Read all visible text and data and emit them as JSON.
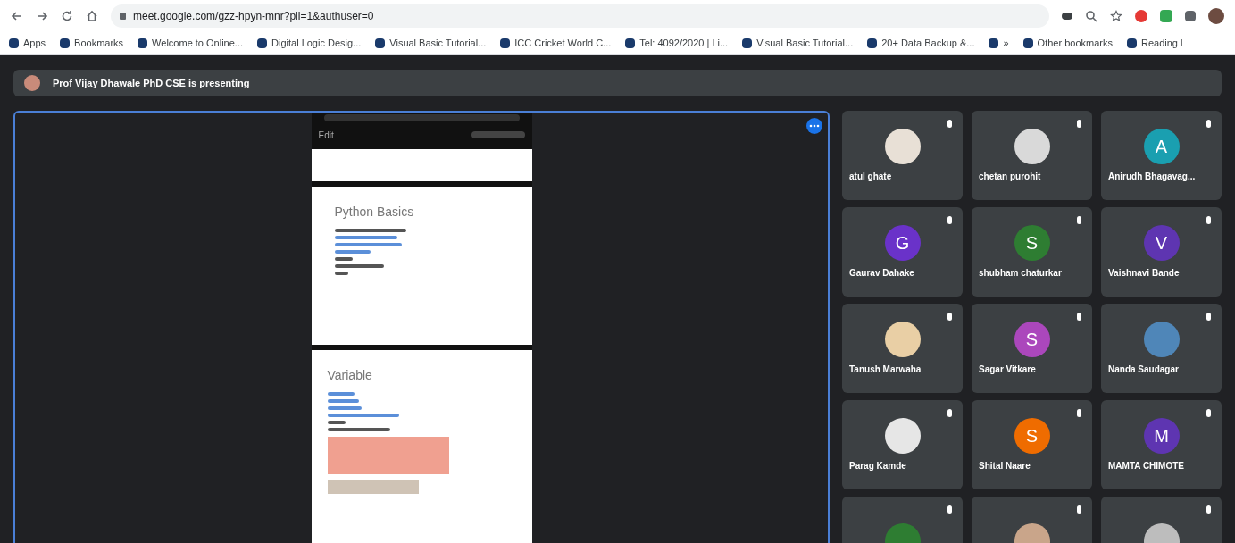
{
  "browser": {
    "url": "meet.google.com/gzz-hpyn-mnr?pli=1&authuser=0",
    "bookmarks": [
      "Apps",
      "Bookmarks",
      "Welcome to Online...",
      "Digital Logic Desig...",
      "Visual Basic Tutorial...",
      "ICC Cricket World C...",
      "Tel: 4092/2020 | Li...",
      "Visual Basic Tutorial...",
      "20+ Data Backup &...",
      "»",
      "Other bookmarks",
      "Reading l"
    ]
  },
  "presenter_bar": {
    "text": "Prof Vijay Dhawale PhD CSE is presenting"
  },
  "shared_screen": {
    "app_title": "Edit",
    "slides": [
      {
        "kind": "blank"
      },
      {
        "kind": "list",
        "title": "Python Basics"
      },
      {
        "kind": "boxes",
        "title": "Variable"
      }
    ]
  },
  "participants": [
    {
      "name": "atul ghate",
      "kind": "photo",
      "color": "#e8e0d6"
    },
    {
      "name": "chetan purohit",
      "kind": "photo",
      "color": "#d9d9d9"
    },
    {
      "name": "Anirudh Bhagavag...",
      "kind": "letter",
      "letter": "A",
      "color": "#1a9fb0"
    },
    {
      "name": "Gaurav Dahake",
      "kind": "letter",
      "letter": "G",
      "color": "#6a32c9"
    },
    {
      "name": "shubham chaturkar",
      "kind": "letter",
      "letter": "S",
      "color": "#2e7d32"
    },
    {
      "name": "Vaishnavi Bande",
      "kind": "letter",
      "letter": "V",
      "color": "#5e35b1"
    },
    {
      "name": "Tanush Marwaha",
      "kind": "photo",
      "color": "#e9cfa5"
    },
    {
      "name": "Sagar Vitkare",
      "kind": "letter",
      "letter": "S",
      "color": "#ab47bc"
    },
    {
      "name": "Nanda Saudagar",
      "kind": "photo",
      "color": "#4f86b8"
    },
    {
      "name": "Parag Kamde",
      "kind": "photo",
      "color": "#e6e6e6"
    },
    {
      "name": "Shital Naare",
      "kind": "letter",
      "letter": "S",
      "color": "#ef6c00"
    },
    {
      "name": "MAMTA CHIMOTE",
      "kind": "letter",
      "letter": "M",
      "color": "#5e35b1"
    },
    {
      "kind": "letter",
      "color": "#2e7d32"
    },
    {
      "kind": "photo",
      "color": "#c9a58a"
    },
    {
      "kind": "photo",
      "color": "#bdbdbd"
    }
  ]
}
